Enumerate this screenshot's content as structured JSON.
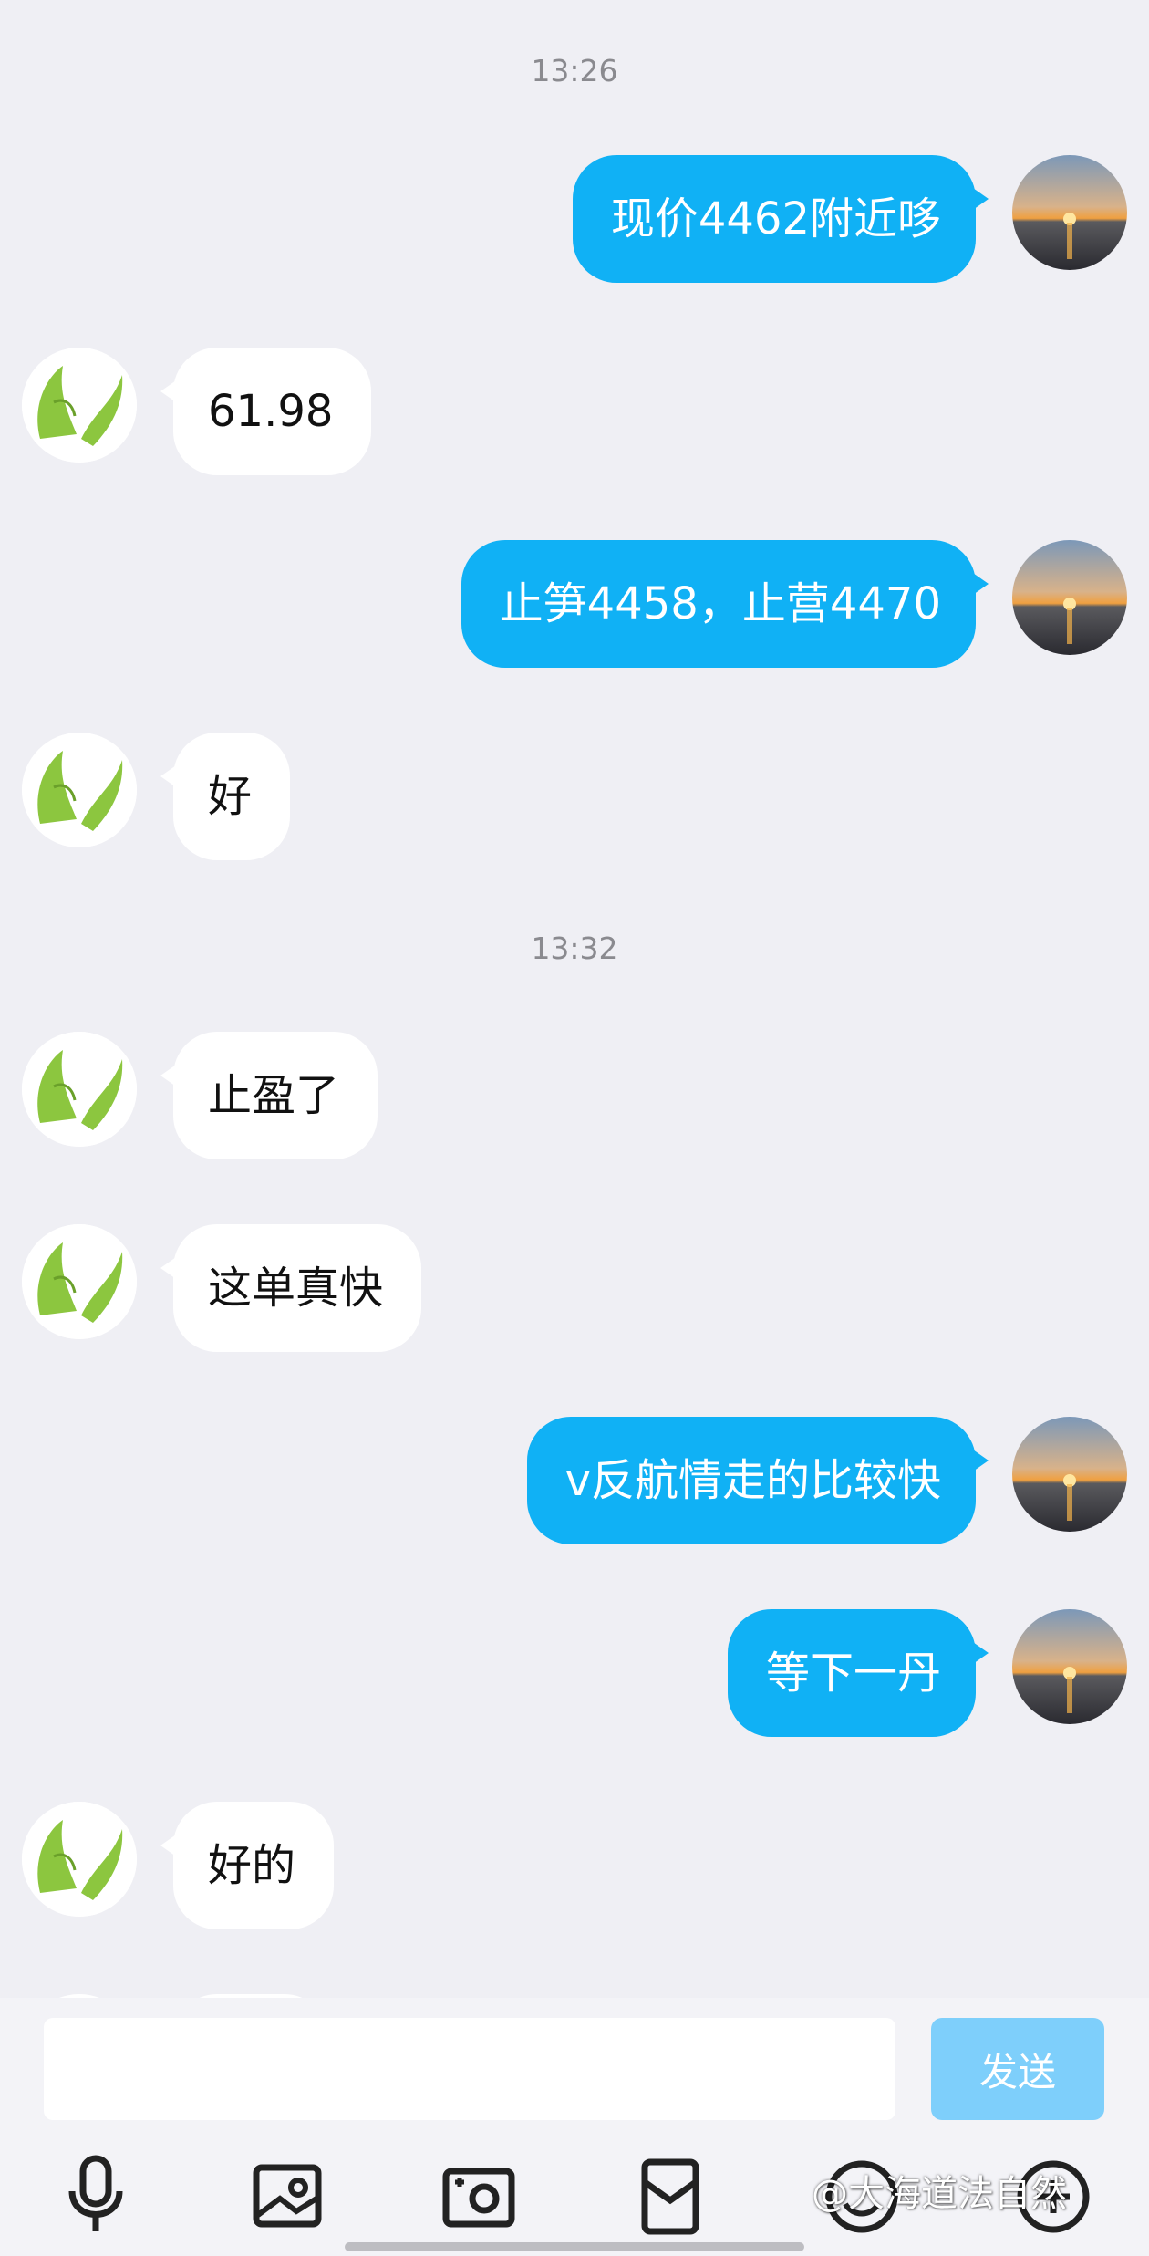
{
  "timestamps": [
    "13:26",
    "13:32"
  ],
  "messages": [
    {
      "side": "out",
      "text": "现价4462附近哆"
    },
    {
      "side": "in",
      "text": "61.98"
    },
    {
      "side": "out",
      "text": "止笋4458，止营4470"
    },
    {
      "side": "in",
      "text": "好"
    },
    {
      "side": "in",
      "text": "止盈了"
    },
    {
      "side": "in",
      "text": "这单真快"
    },
    {
      "side": "out",
      "text": "v反航情走的比较快"
    },
    {
      "side": "out",
      "text": "等下一丹"
    },
    {
      "side": "in",
      "text": "好的"
    }
  ],
  "composer": {
    "input_value": "",
    "send_label": "发送"
  },
  "toolbar_icons": [
    "microphone-icon",
    "image-icon",
    "camera-icon",
    "red-packet-icon",
    "emoji-icon",
    "add-icon"
  ],
  "watermark": "@大海道法自然",
  "colors": {
    "outgoing_bubble": "#10b1f5",
    "incoming_bubble": "#ffffff",
    "background": "#efeff4",
    "send_button": "#7ecffb"
  }
}
